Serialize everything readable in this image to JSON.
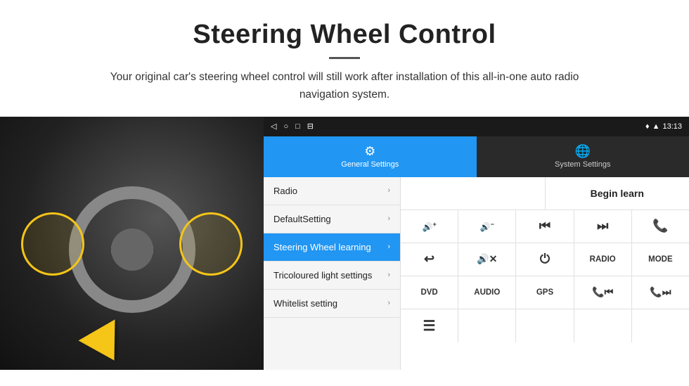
{
  "header": {
    "title": "Steering Wheel Control",
    "subtitle": "Your original car's steering wheel control will still work after installation of this all-in-one auto radio navigation system."
  },
  "status_bar": {
    "nav_back": "◁",
    "nav_home": "○",
    "nav_recent": "□",
    "nav_cast": "⊟",
    "wifi_icon": "▲",
    "signal_icon": "▲",
    "time": "13:13"
  },
  "tabs": [
    {
      "id": "general",
      "label": "General Settings",
      "active": true
    },
    {
      "id": "system",
      "label": "System Settings",
      "active": false
    }
  ],
  "menu_items": [
    {
      "id": "radio",
      "label": "Radio",
      "active": false
    },
    {
      "id": "default",
      "label": "DefaultSetting",
      "active": false
    },
    {
      "id": "steering",
      "label": "Steering Wheel learning",
      "active": true
    },
    {
      "id": "tricoloured",
      "label": "Tricoloured light settings",
      "active": false
    },
    {
      "id": "whitelist",
      "label": "Whitelist setting",
      "active": false
    }
  ],
  "controls": {
    "begin_learn": "Begin learn",
    "row1": [
      {
        "id": "vol_up",
        "icon": "🔊+",
        "text": ""
      },
      {
        "id": "vol_down",
        "icon": "🔊−",
        "text": ""
      },
      {
        "id": "prev",
        "icon": "⏮",
        "text": ""
      },
      {
        "id": "next",
        "icon": "⏭",
        "text": ""
      },
      {
        "id": "phone",
        "icon": "📞",
        "text": ""
      }
    ],
    "row2": [
      {
        "id": "hang_up",
        "icon": "↩",
        "text": ""
      },
      {
        "id": "mute",
        "icon": "🔊×",
        "text": ""
      },
      {
        "id": "power",
        "icon": "⏻",
        "text": ""
      },
      {
        "id": "radio_btn",
        "icon": "",
        "text": "RADIO"
      },
      {
        "id": "mode_btn",
        "icon": "",
        "text": "MODE"
      }
    ],
    "row3": [
      {
        "id": "dvd",
        "icon": "",
        "text": "DVD"
      },
      {
        "id": "audio",
        "icon": "",
        "text": "AUDIO"
      },
      {
        "id": "gps",
        "icon": "",
        "text": "GPS"
      },
      {
        "id": "tel_prev",
        "icon": "📞⏮",
        "text": ""
      },
      {
        "id": "tel_next",
        "icon": "📞⏭",
        "text": ""
      }
    ],
    "row4": [
      {
        "id": "list",
        "icon": "☰",
        "text": ""
      }
    ]
  }
}
